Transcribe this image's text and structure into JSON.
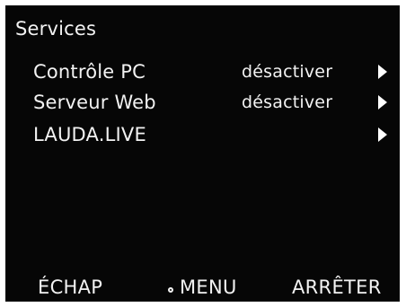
{
  "header": {
    "title": "Services"
  },
  "menu": {
    "items": [
      {
        "label": "Contrôle PC",
        "value": "désactiver"
      },
      {
        "label": "Serveur Web",
        "value": "désactiver"
      },
      {
        "label": "LAUDA.LIVE",
        "value": ""
      }
    ],
    "arrow_icon": "chevron-right-icon"
  },
  "softkeys": {
    "left": "ÉCHAP",
    "center": "MENU",
    "center_icon": "circle-dot-icon",
    "right": "ARRÊTER"
  },
  "colors": {
    "background": "#060606",
    "text": "#f2f2f2"
  }
}
